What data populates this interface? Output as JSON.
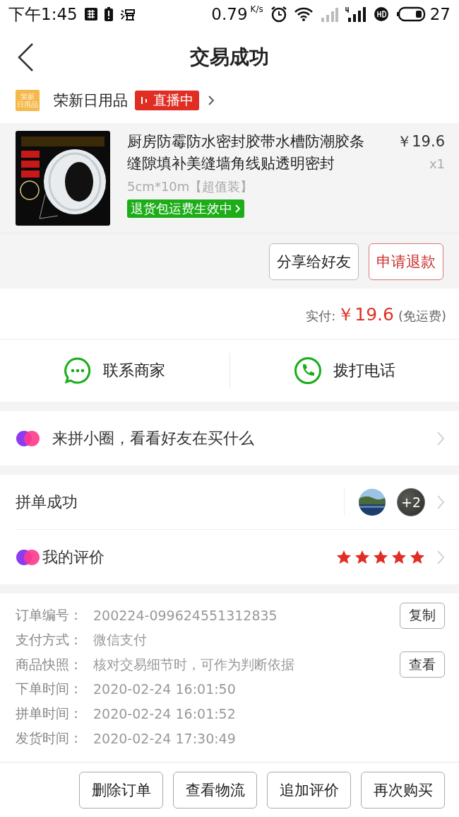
{
  "status_bar": {
    "time": "下午1:45",
    "speed": "0.79",
    "speed_unit": "K/s",
    "battery": "27"
  },
  "header": {
    "title": "交易成功"
  },
  "shop": {
    "logo_lines": [
      "荣新",
      "日用品"
    ],
    "name": "荣新日用品",
    "live_badge": "直播中"
  },
  "product": {
    "title": "厨房防霉防水密封胶带水槽防潮胶条缝隙填补美缝墙角线贴透明密封",
    "price": "￥19.6",
    "quantity": "x1",
    "spec": "5cm*10m【超值装】",
    "badge": "退货包运费生效中"
  },
  "order_actions": [
    {
      "label": "分享给好友",
      "kind": "plain"
    },
    {
      "label": "申请退款",
      "kind": "accent"
    }
  ],
  "payment": {
    "label": "实付:",
    "amount": "￥19.6",
    "note": "(免运费)"
  },
  "contact": [
    {
      "label": "联系商家",
      "kind": "chat"
    },
    {
      "label": "拨打电话",
      "kind": "phone"
    }
  ],
  "circle": {
    "label": "来拼小圈，看看好友在买什么"
  },
  "group": {
    "label": "拼单成功",
    "extra_count": "+2"
  },
  "review": {
    "label": "我的评价",
    "stars": 5
  },
  "details": [
    {
      "label": "订单编号：",
      "value": "200224-099624551312835",
      "button": "复制"
    },
    {
      "label": "支付方式：",
      "value": "微信支付"
    },
    {
      "label": "商品快照：",
      "value": "核对交易细节时，可作为判断依据",
      "button": "查看"
    },
    {
      "label": "下单时间：",
      "value": "2020-02-24 16:01:50"
    },
    {
      "label": "拼单时间：",
      "value": "2020-02-24 16:01:52"
    },
    {
      "label": "发货时间：",
      "value": "2020-02-24 17:30:49"
    }
  ],
  "bottom_buttons": [
    "删除订单",
    "查看物流",
    "追加评价",
    "再次购买"
  ]
}
